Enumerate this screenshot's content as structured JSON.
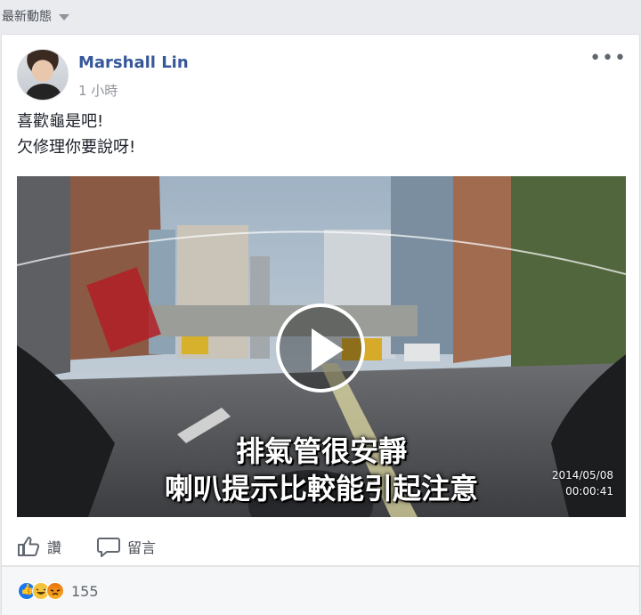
{
  "feed": {
    "header": "最新動態"
  },
  "post": {
    "author": "Marshall Lin",
    "timestamp": "1 小時",
    "text_line1": "喜歡龜是吧!",
    "text_line2": "欠修理你要說呀!",
    "video": {
      "caption_line1": "排氣管很安靜",
      "caption_line2": "喇叭提示比較能引起注意",
      "date": "2014/05/08",
      "time": "00:00:41"
    },
    "actions": {
      "like": "讚",
      "comment": "留言"
    },
    "reactions": {
      "count": "155",
      "types": [
        "like",
        "haha",
        "angry"
      ]
    }
  },
  "colors": {
    "link": "#365899",
    "page_bg": "#e9ebee",
    "like_blue": "#1877f2"
  },
  "icons": {
    "more": "ellipsis-icon",
    "like": "thumbs-up-icon",
    "comment": "comment-icon",
    "play": "play-icon",
    "caret": "caret-down-icon"
  }
}
